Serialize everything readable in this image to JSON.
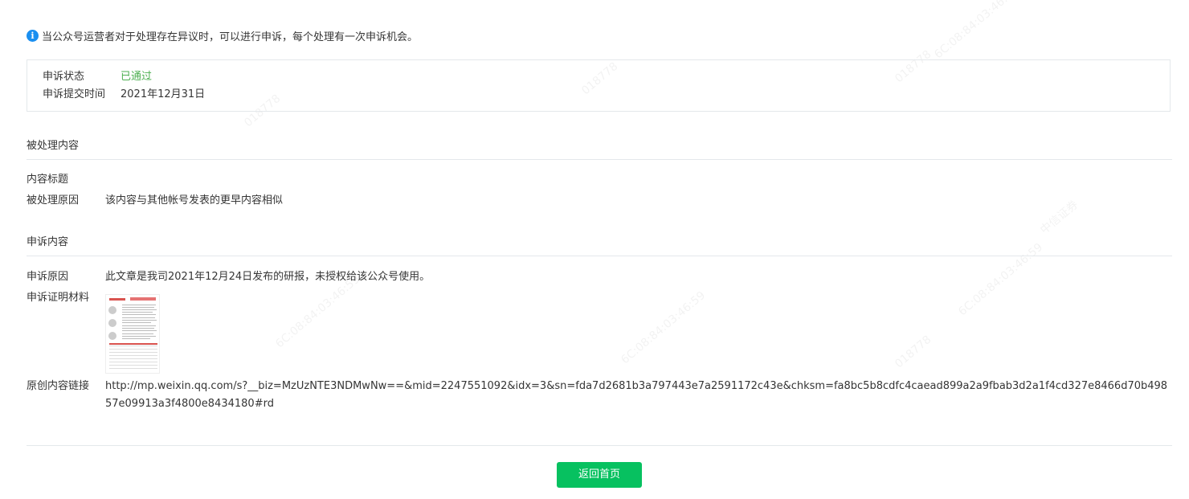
{
  "notice": {
    "icon": "info-icon",
    "text": "当公众号运营者对于处理存在异议时，可以进行申诉，每个处理有一次申诉机会。"
  },
  "appeal_status": {
    "status_label": "申诉状态",
    "status_value": "已通过",
    "status_color": "#4caf50",
    "submit_label": "申诉提交时间",
    "submit_value": "2021年12月31日"
  },
  "processed": {
    "section_title": "被处理内容",
    "title_label": "内容标题",
    "title_value": "",
    "reason_label": "被处理原因",
    "reason_value": "该内容与其他帐号发表的更早内容相似"
  },
  "appeal": {
    "section_title": "申诉内容",
    "reason_label": "申诉原因",
    "reason_value": "此文章是我司2021年12月24日发布的研报，未授权给该公众号使用。",
    "evidence_label": "申诉证明材料",
    "link_label": "原创内容链接",
    "link_value": "http://mp.weixin.qq.com/s?__biz=MzUzNTE3NDMwNw==&mid=2247551092&idx=3&sn=fda7d2681b3a797443e7a2591172c43e&chksm=fa8bc5b8cdfc4caead899a2a9fbab3d2a1f4cd327e8466d70b49857e09913a3f4800e8434180#rd"
  },
  "footer": {
    "home_button": "返回首页",
    "button_color": "#07c160"
  },
  "watermark_texts": [
    "018778",
    "6C:08:84:03:46:59",
    "中信证券"
  ]
}
